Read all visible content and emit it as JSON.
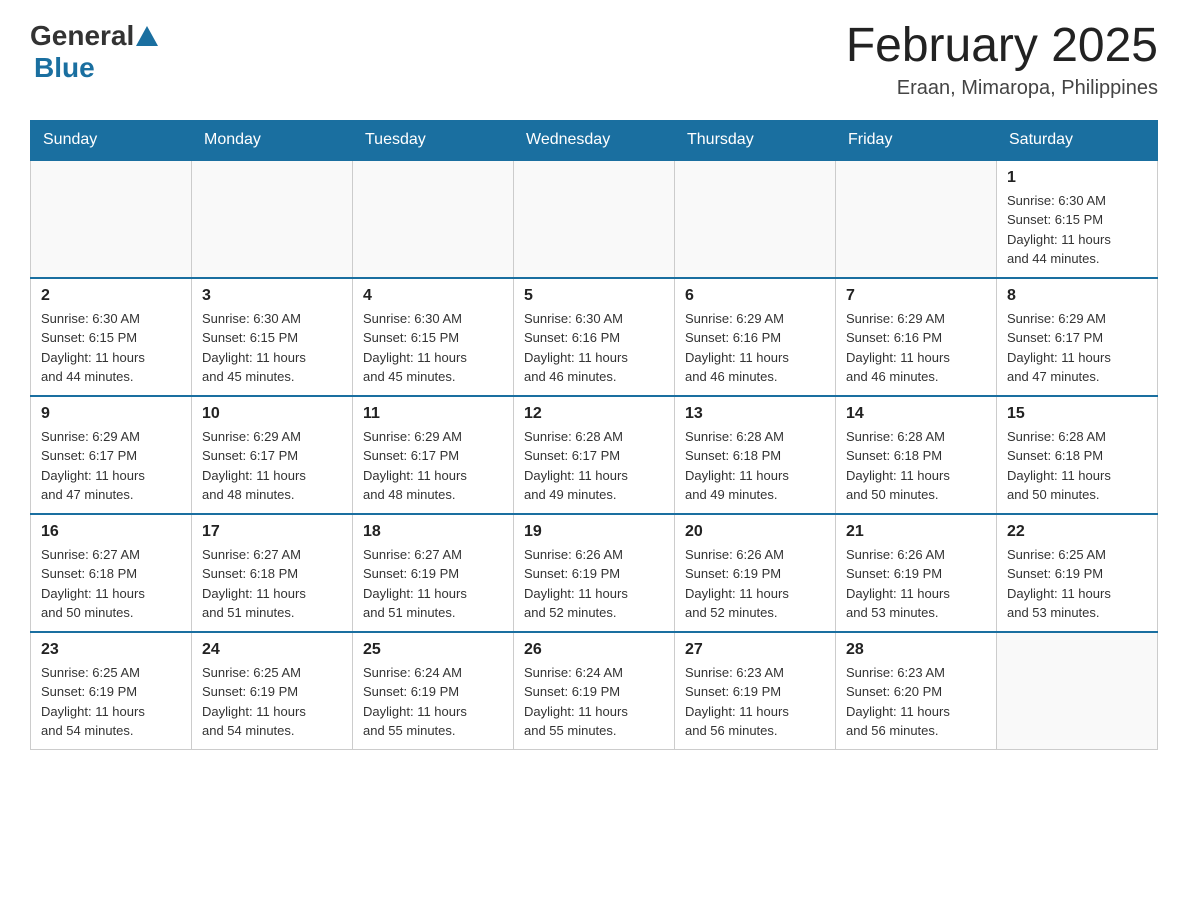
{
  "logo": {
    "text1": "General",
    "text2": "Blue"
  },
  "header": {
    "title": "February 2025",
    "location": "Eraan, Mimaropa, Philippines"
  },
  "weekdays": [
    "Sunday",
    "Monday",
    "Tuesday",
    "Wednesday",
    "Thursday",
    "Friday",
    "Saturday"
  ],
  "weeks": [
    [
      {
        "day": "",
        "info": ""
      },
      {
        "day": "",
        "info": ""
      },
      {
        "day": "",
        "info": ""
      },
      {
        "day": "",
        "info": ""
      },
      {
        "day": "",
        "info": ""
      },
      {
        "day": "",
        "info": ""
      },
      {
        "day": "1",
        "info": "Sunrise: 6:30 AM\nSunset: 6:15 PM\nDaylight: 11 hours\nand 44 minutes."
      }
    ],
    [
      {
        "day": "2",
        "info": "Sunrise: 6:30 AM\nSunset: 6:15 PM\nDaylight: 11 hours\nand 44 minutes."
      },
      {
        "day": "3",
        "info": "Sunrise: 6:30 AM\nSunset: 6:15 PM\nDaylight: 11 hours\nand 45 minutes."
      },
      {
        "day": "4",
        "info": "Sunrise: 6:30 AM\nSunset: 6:15 PM\nDaylight: 11 hours\nand 45 minutes."
      },
      {
        "day": "5",
        "info": "Sunrise: 6:30 AM\nSunset: 6:16 PM\nDaylight: 11 hours\nand 46 minutes."
      },
      {
        "day": "6",
        "info": "Sunrise: 6:29 AM\nSunset: 6:16 PM\nDaylight: 11 hours\nand 46 minutes."
      },
      {
        "day": "7",
        "info": "Sunrise: 6:29 AM\nSunset: 6:16 PM\nDaylight: 11 hours\nand 46 minutes."
      },
      {
        "day": "8",
        "info": "Sunrise: 6:29 AM\nSunset: 6:17 PM\nDaylight: 11 hours\nand 47 minutes."
      }
    ],
    [
      {
        "day": "9",
        "info": "Sunrise: 6:29 AM\nSunset: 6:17 PM\nDaylight: 11 hours\nand 47 minutes."
      },
      {
        "day": "10",
        "info": "Sunrise: 6:29 AM\nSunset: 6:17 PM\nDaylight: 11 hours\nand 48 minutes."
      },
      {
        "day": "11",
        "info": "Sunrise: 6:29 AM\nSunset: 6:17 PM\nDaylight: 11 hours\nand 48 minutes."
      },
      {
        "day": "12",
        "info": "Sunrise: 6:28 AM\nSunset: 6:17 PM\nDaylight: 11 hours\nand 49 minutes."
      },
      {
        "day": "13",
        "info": "Sunrise: 6:28 AM\nSunset: 6:18 PM\nDaylight: 11 hours\nand 49 minutes."
      },
      {
        "day": "14",
        "info": "Sunrise: 6:28 AM\nSunset: 6:18 PM\nDaylight: 11 hours\nand 50 minutes."
      },
      {
        "day": "15",
        "info": "Sunrise: 6:28 AM\nSunset: 6:18 PM\nDaylight: 11 hours\nand 50 minutes."
      }
    ],
    [
      {
        "day": "16",
        "info": "Sunrise: 6:27 AM\nSunset: 6:18 PM\nDaylight: 11 hours\nand 50 minutes."
      },
      {
        "day": "17",
        "info": "Sunrise: 6:27 AM\nSunset: 6:18 PM\nDaylight: 11 hours\nand 51 minutes."
      },
      {
        "day": "18",
        "info": "Sunrise: 6:27 AM\nSunset: 6:19 PM\nDaylight: 11 hours\nand 51 minutes."
      },
      {
        "day": "19",
        "info": "Sunrise: 6:26 AM\nSunset: 6:19 PM\nDaylight: 11 hours\nand 52 minutes."
      },
      {
        "day": "20",
        "info": "Sunrise: 6:26 AM\nSunset: 6:19 PM\nDaylight: 11 hours\nand 52 minutes."
      },
      {
        "day": "21",
        "info": "Sunrise: 6:26 AM\nSunset: 6:19 PM\nDaylight: 11 hours\nand 53 minutes."
      },
      {
        "day": "22",
        "info": "Sunrise: 6:25 AM\nSunset: 6:19 PM\nDaylight: 11 hours\nand 53 minutes."
      }
    ],
    [
      {
        "day": "23",
        "info": "Sunrise: 6:25 AM\nSunset: 6:19 PM\nDaylight: 11 hours\nand 54 minutes."
      },
      {
        "day": "24",
        "info": "Sunrise: 6:25 AM\nSunset: 6:19 PM\nDaylight: 11 hours\nand 54 minutes."
      },
      {
        "day": "25",
        "info": "Sunrise: 6:24 AM\nSunset: 6:19 PM\nDaylight: 11 hours\nand 55 minutes."
      },
      {
        "day": "26",
        "info": "Sunrise: 6:24 AM\nSunset: 6:19 PM\nDaylight: 11 hours\nand 55 minutes."
      },
      {
        "day": "27",
        "info": "Sunrise: 6:23 AM\nSunset: 6:19 PM\nDaylight: 11 hours\nand 56 minutes."
      },
      {
        "day": "28",
        "info": "Sunrise: 6:23 AM\nSunset: 6:20 PM\nDaylight: 11 hours\nand 56 minutes."
      },
      {
        "day": "",
        "info": ""
      }
    ]
  ]
}
